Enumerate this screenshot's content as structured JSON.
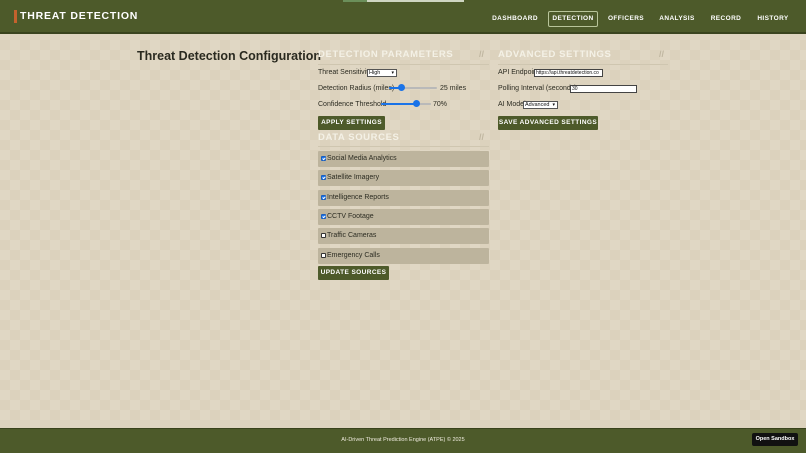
{
  "header": {
    "logo": "THREAT DETECTION",
    "nav": [
      "DASHBOARD",
      "DETECTION",
      "OFFICERS",
      "ANALYSIS",
      "RECORD",
      "HISTORY"
    ],
    "active_nav": "DETECTION"
  },
  "page_title": "Threat Detection Configuration",
  "detection": {
    "heading": "DETECTION PARAMETERS",
    "sensitivity_label": "Threat Sensitivity",
    "sensitivity_value": "High",
    "radius_label": "Detection Radius (miles)",
    "radius_value": 25,
    "radius_display": "25 miles",
    "confidence_label": "Confidence Threshold",
    "confidence_value": 70,
    "confidence_display": "70%",
    "apply_button": "APPLY SETTINGS"
  },
  "advanced": {
    "heading": "ADVANCED SETTINGS",
    "api_label": "API Endpoint",
    "api_value": "https://api.threatdetection.co",
    "polling_label": "Polling Interval (seconds)",
    "polling_value": "30",
    "model_label": "AI Model",
    "model_value": "Advanced",
    "save_button": "SAVE ADVANCED SETTINGS"
  },
  "sources": {
    "heading": "DATA SOURCES",
    "items": [
      {
        "label": "Social Media Analytics",
        "checked": true
      },
      {
        "label": "Satellite Imagery",
        "checked": true
      },
      {
        "label": "Intelligence Reports",
        "checked": true
      },
      {
        "label": "CCTV Footage",
        "checked": true
      },
      {
        "label": "Traffic Cameras",
        "checked": false
      },
      {
        "label": "Emergency Calls",
        "checked": false
      }
    ],
    "update_button": "UPDATE SOURCES"
  },
  "footer": {
    "text": "AI-Driven Threat Prediction Engine (ATPE) © 2025",
    "sandbox_button": "Open Sandbox"
  },
  "colors": {
    "header_bg": "#4d5a2a",
    "accent": "#c4622d",
    "slider": "#1a73e8",
    "source_row_bg": "#bdb49d"
  }
}
